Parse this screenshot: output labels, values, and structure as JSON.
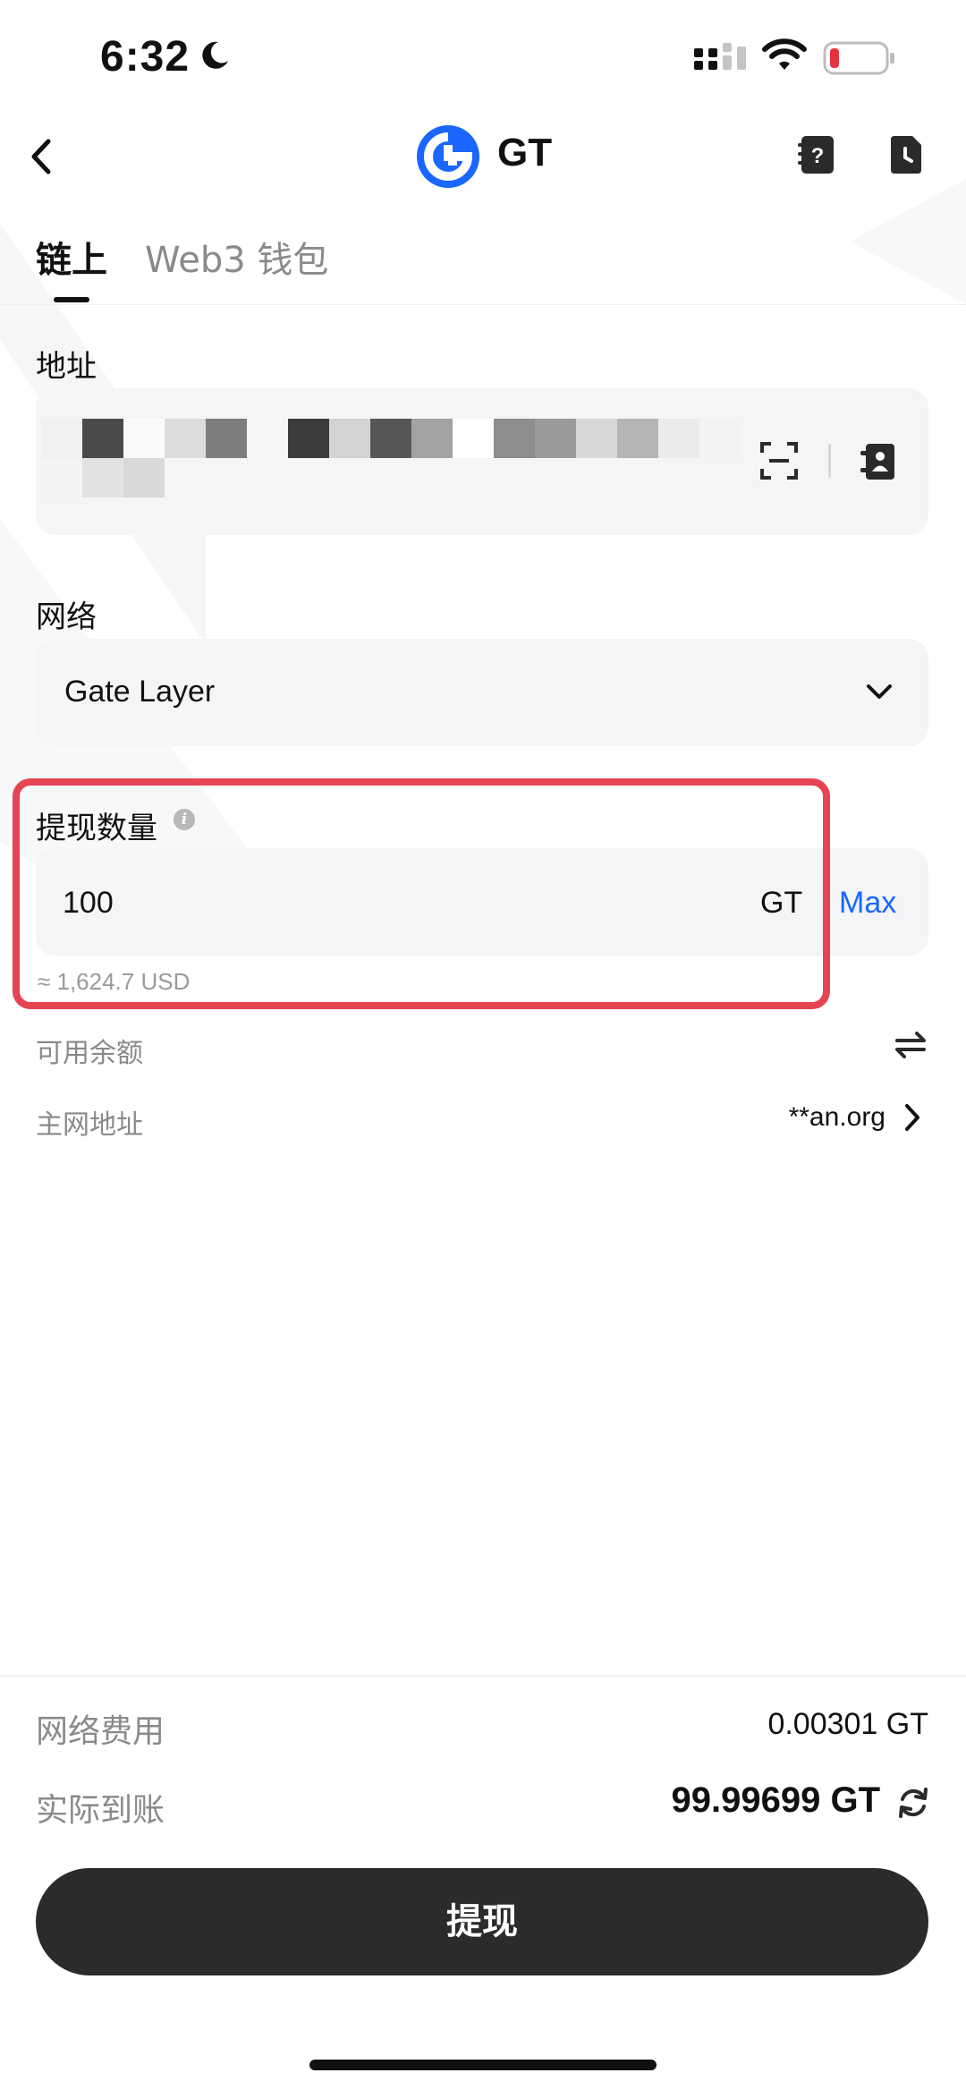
{
  "status_bar": {
    "time": "6:32"
  },
  "header": {
    "title": "GT",
    "coin_icon": "gt-coin-icon",
    "help_icon": "help-doc-icon",
    "history_icon": "history-doc-icon"
  },
  "tabs": [
    {
      "label": "链上",
      "active": true
    },
    {
      "label": "Web3 钱包",
      "active": false
    }
  ],
  "address": {
    "label": "地址"
  },
  "network": {
    "label": "网络",
    "value": "Gate Layer"
  },
  "amount": {
    "label": "提现数量",
    "value": "100",
    "unit": "GT",
    "max_label": "Max",
    "usd_estimate": "≈ 1,624.7 USD"
  },
  "available": {
    "label": "可用余额"
  },
  "mainnet": {
    "label": "主网地址",
    "value": "**an.org"
  },
  "fee": {
    "label": "网络费用",
    "value": "0.00301 GT"
  },
  "received": {
    "label": "实际到账",
    "value": "99.99699 GT"
  },
  "submit": {
    "label": "提现"
  },
  "colors": {
    "accent_blue": "#1a66ff",
    "highlight_red": "#e64452",
    "button_dark": "#2b2b2b",
    "battery_low": "#e6323e"
  }
}
